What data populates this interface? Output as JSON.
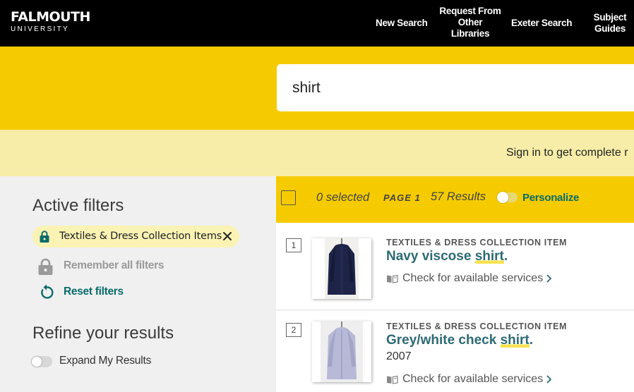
{
  "header": {
    "logo_main": "FALMOUTH",
    "logo_sub": "UNIVERSITY",
    "nav": {
      "new_search": "New Search",
      "request_line1": "Request From",
      "request_line2": "Other",
      "request_line3": "Libraries",
      "exeter_search": "Exeter Search",
      "subject_line1": "Subject",
      "subject_line2": "Guides"
    }
  },
  "search": {
    "value": "shirt"
  },
  "signin_banner": {
    "text": "Sign in to get complete r"
  },
  "filters": {
    "active_heading": "Active filters",
    "active_chip_label": "Textiles & Dress Collection Items",
    "remember_label": "Remember all filters",
    "reset_label": "Reset filters",
    "refine_heading": "Refine your results",
    "expand_label": "Expand My Results"
  },
  "toolbar": {
    "selected": "0 selected",
    "page": "PAGE 1",
    "results": "57 Results",
    "personalize": "Personalize"
  },
  "results": [
    {
      "number": "1",
      "type": "TEXTILES & DRESS COLLECTION ITEM",
      "title_before": "Navy viscose ",
      "title_highlight": "shirt",
      "title_after": ".",
      "availability": "Check for available services",
      "garment_color": "#1e2447"
    },
    {
      "number": "2",
      "type": "TEXTILES & DRESS COLLECTION ITEM",
      "title_before": "Grey/white check ",
      "title_highlight": "shirt",
      "title_after": ".",
      "date": "2007",
      "availability": "Check for available services",
      "garment_color": "#b7b9d6"
    }
  ],
  "colors": {
    "brand_yellow": "#f5cb00",
    "teal": "#0a6b6b",
    "title_blue": "#2d6a74"
  }
}
